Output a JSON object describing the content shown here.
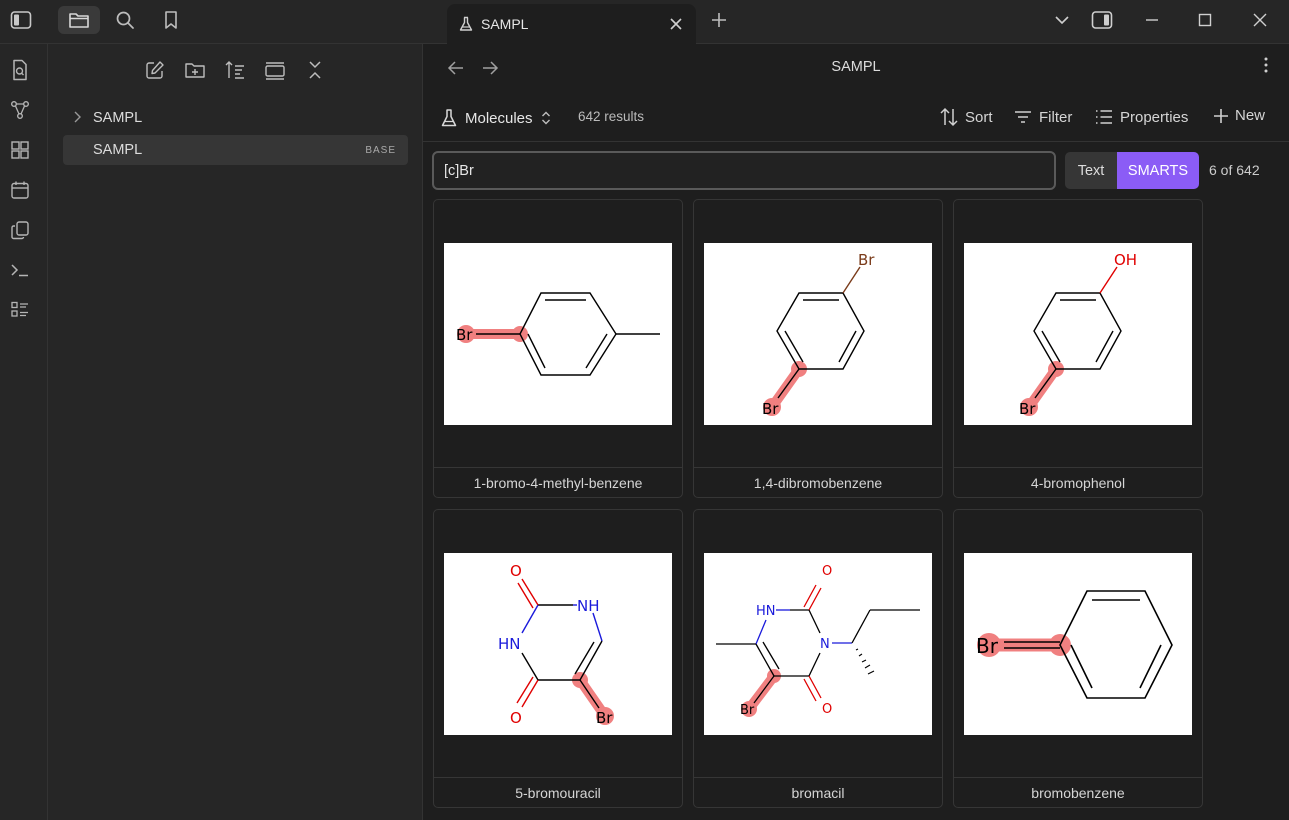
{
  "tab": {
    "title": "SAMPL"
  },
  "sidebar": {
    "items": [
      {
        "label": "SAMPL",
        "badge": ""
      },
      {
        "label": "SAMPL",
        "badge": "BASE"
      }
    ]
  },
  "main": {
    "title": "SAMPL",
    "view_name": "Molecules",
    "results": "642 results",
    "toolbar": {
      "sort": "Sort",
      "filter": "Filter",
      "properties": "Properties",
      "new": "New"
    },
    "search": {
      "value": "[c]Br"
    },
    "mode": {
      "text": "Text",
      "smarts": "SMARTS",
      "active": "SMARTS"
    },
    "match_count": "6 of 642",
    "cards": [
      {
        "name": "1-bromo-4-methyl-benzene"
      },
      {
        "name": "1,4-dibromobenzene"
      },
      {
        "name": "4-bromophenol"
      },
      {
        "name": "5-bromouracil"
      },
      {
        "name": "bromacil"
      },
      {
        "name": "bromobenzene"
      }
    ],
    "atoms": {
      "br": "Br",
      "oh": "OH",
      "o": "O",
      "nh": "NH",
      "hn": "HN",
      "n": "N"
    }
  },
  "colors": {
    "accent": "#8b5cf6",
    "highlight": "#f08080",
    "oxygen": "#e00000",
    "nitrogen": "#1a1adb",
    "bromine": "#7a3b1a"
  }
}
